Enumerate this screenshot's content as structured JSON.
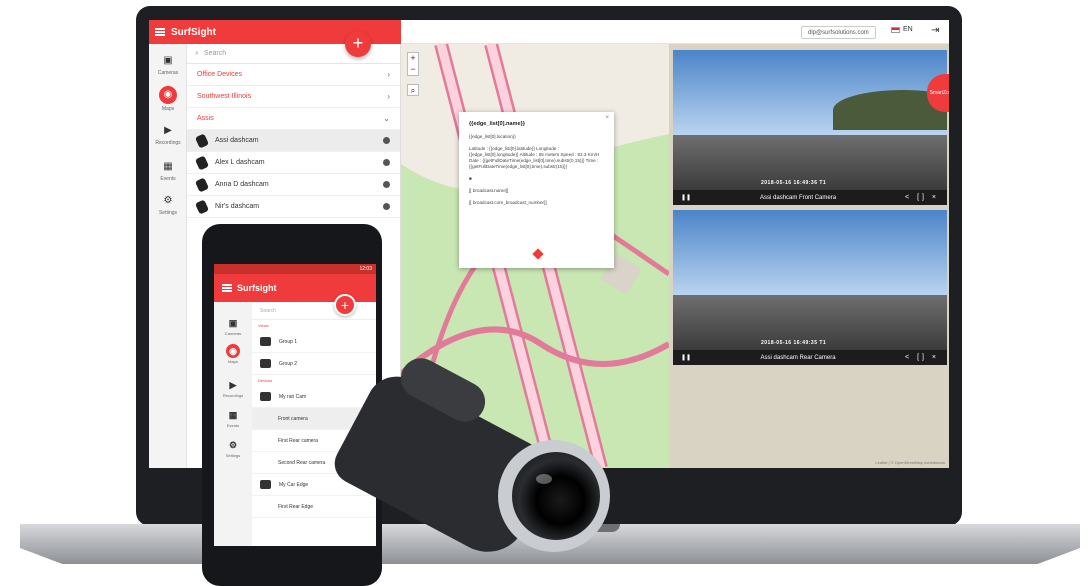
{
  "app": {
    "brand": "SurfSight",
    "email": "dlp@surfsolutions.com",
    "lang": "EN"
  },
  "rail": [
    {
      "icon": "camera-icon",
      "label": "Cameras"
    },
    {
      "icon": "map-pin-icon",
      "label": "Maps",
      "active": true
    },
    {
      "icon": "video-icon",
      "label": "Recordings"
    },
    {
      "icon": "calendar-icon",
      "label": "Events"
    },
    {
      "icon": "gear-icon",
      "label": "Settings"
    }
  ],
  "list": {
    "search_placeholder": "Search",
    "groups": [
      "Office Devices",
      "Southwest Illinois",
      "Assis"
    ],
    "cameras": [
      "Assi dashcam",
      "Alex L dashcam",
      "Anna D dashcam",
      "Nir's dashcam"
    ]
  },
  "popup": {
    "title": "{{edge_list[0].name}}",
    "line1": "{{edge_list[0].location}}",
    "line2": "Latitude : {{edge_list[0].latitude}} Longitude : {{edge_list[0].longitude}} Altitude : 55 meters Speed : 82.3 Km/H Date : {{getFullDateTime(edge_list[0].time).substr(0,15)}} Time : {{getFullDateTime(edge_list[0].time).substr(15)}}",
    "line3": "[[ broadcast.name]]",
    "line4": "[[ broadcast.core_broadcast_number]]"
  },
  "videos": [
    {
      "timestamp": "2018-05-16 16:49:36 T1",
      "title": "Assi dashcam Front Camera"
    },
    {
      "timestamp": "2018-05-16 16:49:35 T1",
      "title": "Assi dashcam Rear Camera"
    }
  ],
  "videos_tab": "SmartZone",
  "map_footer": "Leaflet | © OpenStreetMap contributors",
  "phone": {
    "status": "12:03",
    "brand": "Surfsight",
    "search_placeholder": "Search",
    "section1": "Views",
    "items": [
      {
        "label": "Group 1",
        "sub": false,
        "sel": false
      },
      {
        "label": "Group 2",
        "sub": false,
        "sel": false
      }
    ],
    "section2": "Devices",
    "device1": "My ran Cam",
    "subitems": [
      {
        "label": "Front camera",
        "sel": true
      },
      {
        "label": "First Rear camera",
        "sel": false
      },
      {
        "label": "Second Rear camera",
        "sel": false
      }
    ],
    "device2": "My Car Edge",
    "subitem2": "First Rear Edge",
    "rail": [
      "Cameras",
      "Maps",
      "Recordings",
      "Events",
      "Settings"
    ]
  },
  "colors": {
    "accent": "#ef3b3b"
  }
}
